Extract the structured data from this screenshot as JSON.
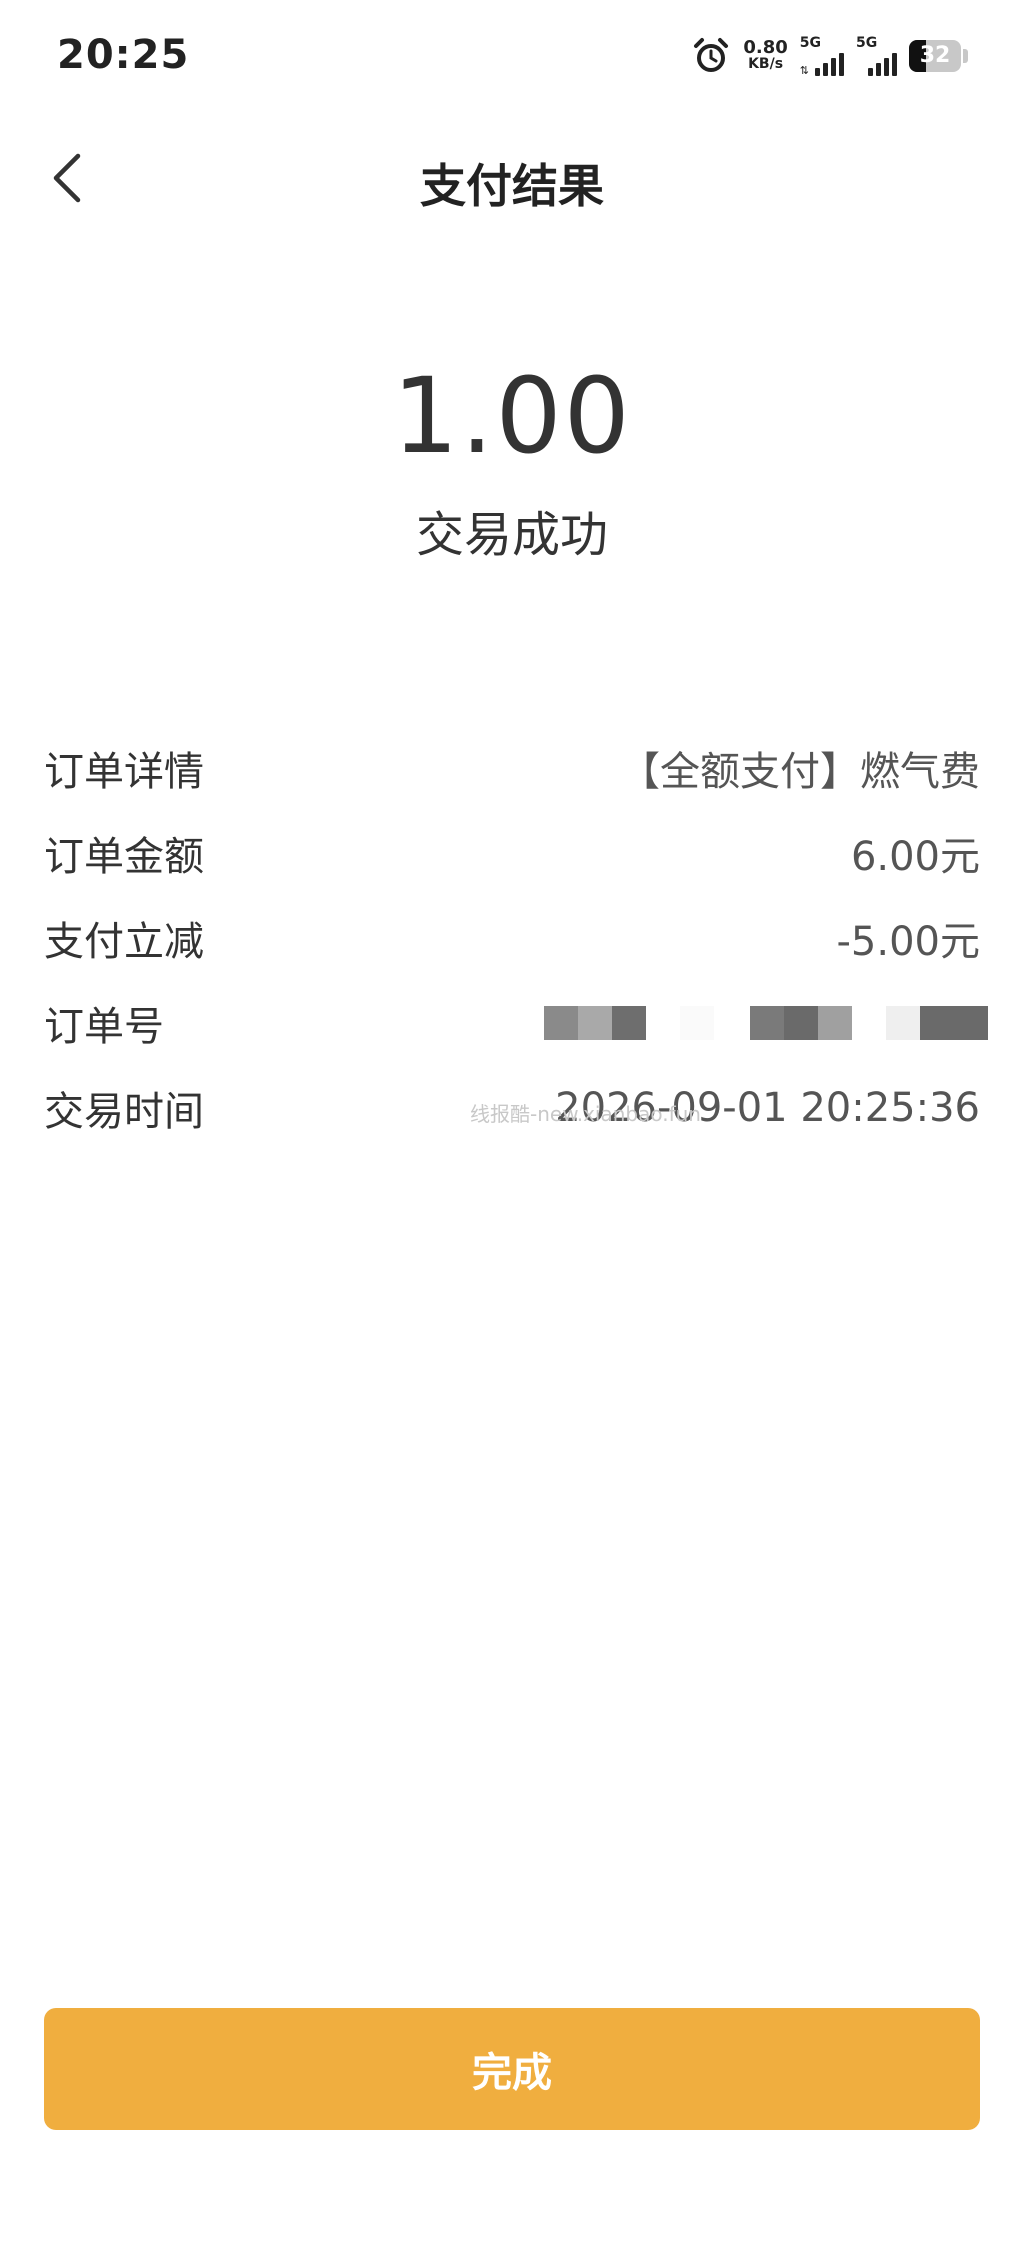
{
  "status_bar": {
    "time": "20:25",
    "net_speed_value": "0.80",
    "net_speed_unit": "KB/s",
    "sim1_label": "5G",
    "sim2_label": "5G",
    "battery_level": "32",
    "battery_percent": 32
  },
  "header": {
    "title": "支付结果"
  },
  "result": {
    "amount": "1.00",
    "status": "交易成功"
  },
  "details": {
    "order_detail_label": "订单详情",
    "order_detail_value": "【全额支付】燃气费",
    "order_amount_label": "订单金额",
    "order_amount_value": "6.00元",
    "discount_label": "支付立减",
    "discount_value": "-5.00元",
    "order_no_label": "订单号",
    "trade_time_label": "交易时间",
    "trade_time_value": "2026-09-01 20:25:36"
  },
  "watermark": "线报酷-new.xianbao.fun",
  "done_button": {
    "label": "完成"
  },
  "colors": {
    "accent": "#f0ae3f",
    "text_primary": "#333333",
    "background": "#ffffff"
  }
}
